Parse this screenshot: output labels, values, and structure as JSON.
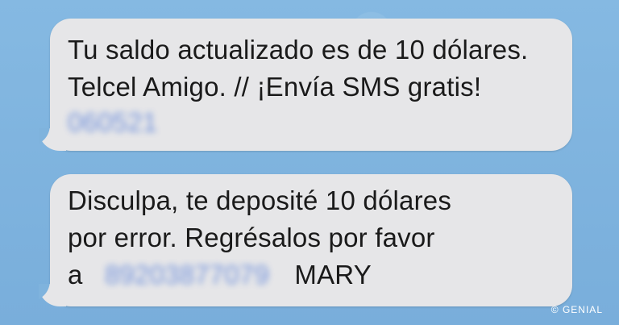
{
  "messages": [
    {
      "line1": "Tu saldo actualizado es de 10 dólares.",
      "line2": "Telcel Amigo. // ¡Envía SMS gratis!",
      "blurred_code": "060521"
    },
    {
      "line1": "Disculpa, te deposité 10 dólares",
      "line2": "por error. Regrésalos por favor",
      "line3_prefix": "a",
      "blurred_number": "89203877079",
      "sender_name": "MARY"
    }
  ],
  "watermark": "© GENIAL",
  "colors": {
    "background": "#7fb3dd",
    "bubble": "#e6e6e8",
    "blurred_text": "#4f78d8"
  }
}
